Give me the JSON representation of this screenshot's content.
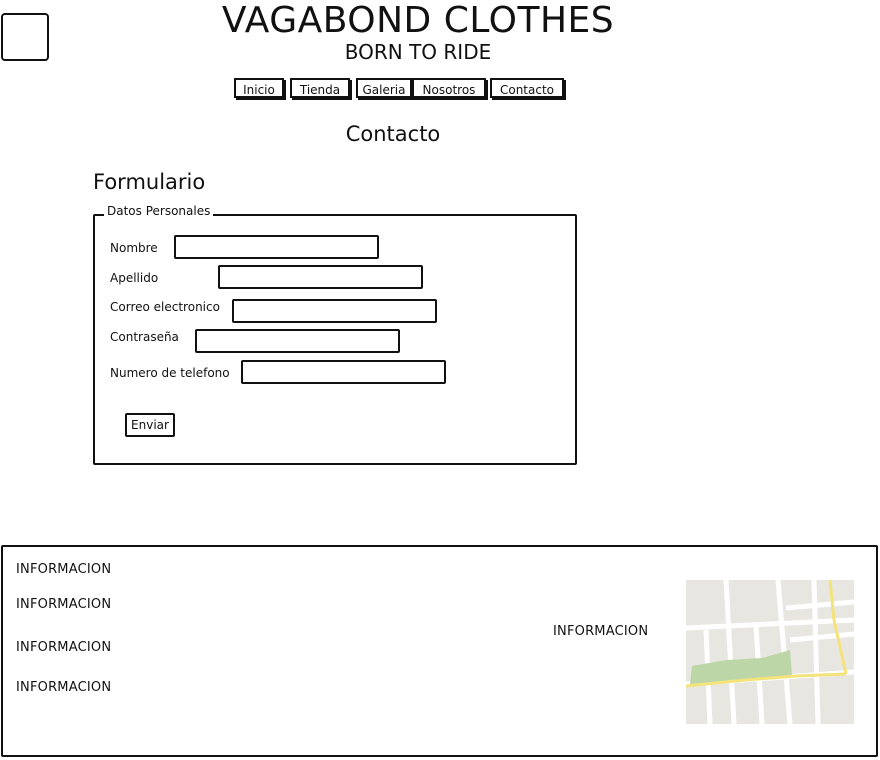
{
  "header": {
    "brand": "VAGABOND CLOTHES",
    "tagline": "BORN TO RIDE"
  },
  "nav": {
    "items": [
      "Inicio",
      "Tienda",
      "Galeria",
      "Nosotros",
      "Contacto"
    ]
  },
  "page": {
    "heading": "Contacto",
    "form_title": "Formulario",
    "legend": "Datos Personales"
  },
  "form": {
    "fields": [
      {
        "label": "Nombre",
        "value": ""
      },
      {
        "label": "Apellido",
        "value": ""
      },
      {
        "label": "Correo electronico",
        "value": ""
      },
      {
        "label": "Contraseña",
        "value": ""
      },
      {
        "label": "Numero de telefono",
        "value": ""
      }
    ],
    "submit_label": "Enviar"
  },
  "footer": {
    "info": [
      "INFORMACION",
      "INFORMACION",
      "INFORMACION",
      "INFORMACION"
    ],
    "center_info": "INFORMACION"
  },
  "colors": {
    "map_bg": "#e8e6e1",
    "map_road": "#ffffff",
    "map_park": "#bcd6a8",
    "map_highway": "#f3e37a"
  }
}
